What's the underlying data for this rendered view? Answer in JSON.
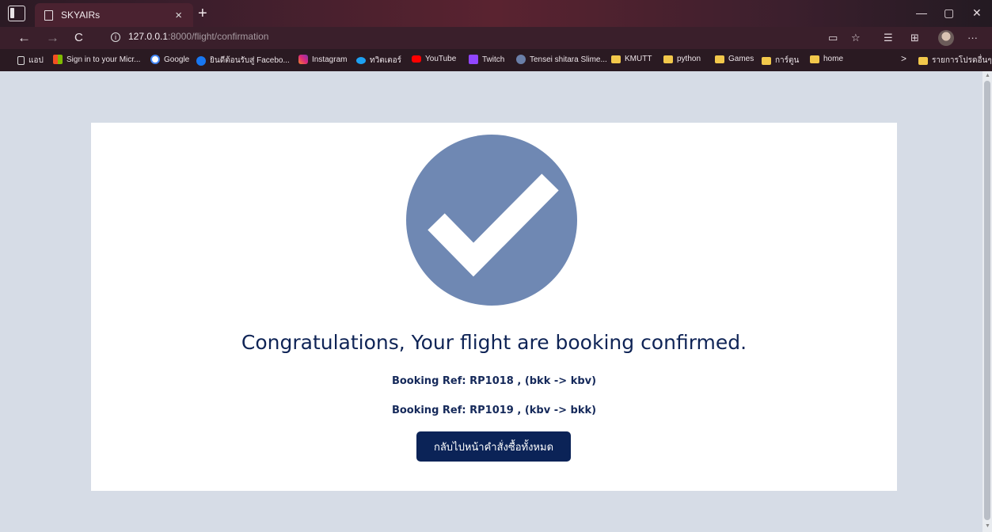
{
  "browser": {
    "tab_title": "SKYAIRs",
    "tab_close": "×",
    "new_tab": "+",
    "url_host": "127.0.0.1",
    "url_path": ":8000/flight/confirmation",
    "info_glyph": "i",
    "back_glyph": "←",
    "forward_glyph": "→",
    "reload_glyph": "C",
    "minimize_glyph": "—",
    "restore_glyph": "▢",
    "close_glyph": "✕",
    "more_glyph": "···",
    "reading_glyph": "▭",
    "favorite_glyph": "☆",
    "favorites_glyph": "☰",
    "collections_glyph": "⊞"
  },
  "bookmarks": {
    "items": [
      {
        "label": "แอป",
        "icon": "page-icon"
      },
      {
        "label": "Sign in to your Micr...",
        "icon": "microsoft-icon"
      },
      {
        "label": "Google",
        "icon": "google-icon"
      },
      {
        "label": "ยินดีต้อนรับสู่ Facebo...",
        "icon": "facebook-icon"
      },
      {
        "label": "Instagram",
        "icon": "instagram-icon"
      },
      {
        "label": "ทวิตเตอร์",
        "icon": "twitter-icon"
      },
      {
        "label": "YouTube",
        "icon": "youtube-icon"
      },
      {
        "label": "Twitch",
        "icon": "twitch-icon"
      },
      {
        "label": "Tensei shitara Slime...",
        "icon": "anime-icon"
      },
      {
        "label": "KMUTT",
        "icon": "folder-icon"
      },
      {
        "label": "python",
        "icon": "folder-icon"
      },
      {
        "label": "Games",
        "icon": "folder-icon"
      },
      {
        "label": "การ์ตูน",
        "icon": "folder-icon"
      },
      {
        "label": "home",
        "icon": "folder-icon"
      }
    ],
    "overflow_glyph": ">",
    "other_label": "รายการโปรดอื่นๆ"
  },
  "colors": {
    "accent": "#0b2357",
    "check_circle": "#6f88b3",
    "page_bg": "#d6dce6",
    "card_bg": "#ffffff"
  },
  "confirmation": {
    "headline": "Congratulations, Your flight are booking confirmed.",
    "refs": [
      "Booking Ref: RP1018 , (bkk -> kbv)",
      "Booking Ref: RP1019 , (kbv -> bkk)"
    ],
    "back_button_label": "กลับไปหน้าคำสั่งซื้อทั้งหมด"
  }
}
